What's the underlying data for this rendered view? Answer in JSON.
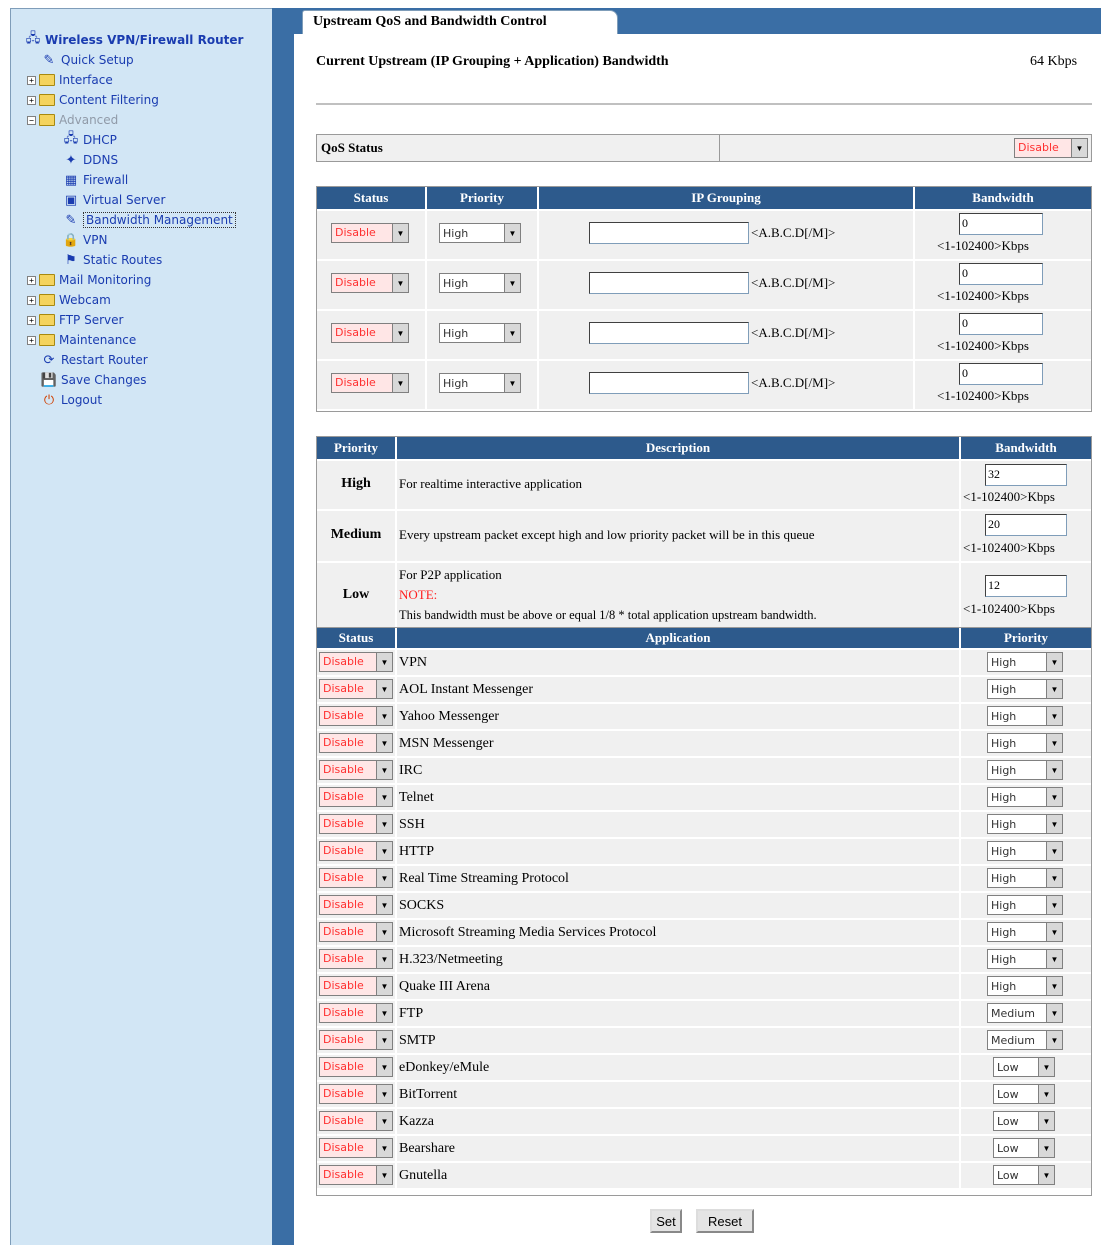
{
  "sidebar": {
    "root": "Wireless VPN/Firewall Router",
    "items": [
      {
        "label": "Quick Setup"
      },
      {
        "label": "Interface"
      },
      {
        "label": "Content Filtering"
      },
      {
        "label": "Advanced"
      },
      {
        "label": "DHCP"
      },
      {
        "label": "DDNS"
      },
      {
        "label": "Firewall"
      },
      {
        "label": "Virtual Server"
      },
      {
        "label": "Bandwidth Management"
      },
      {
        "label": "VPN"
      },
      {
        "label": "Static Routes"
      },
      {
        "label": "Mail Monitoring"
      },
      {
        "label": "Webcam"
      },
      {
        "label": "FTP Server"
      },
      {
        "label": "Maintenance"
      },
      {
        "label": "Restart Router"
      },
      {
        "label": "Save Changes"
      },
      {
        "label": "Logout"
      }
    ]
  },
  "tab": {
    "title": "Upstream QoS and Bandwidth Control"
  },
  "current": {
    "label": "Current Upstream (IP Grouping + Application) Bandwidth",
    "value": "64 Kbps"
  },
  "qos": {
    "label": "QoS Status",
    "value": "Disable"
  },
  "ip_table": {
    "headers": [
      "Status",
      "Priority",
      "IP Grouping",
      "Bandwidth"
    ],
    "rows": [
      {
        "status": "Disable",
        "priority": "High",
        "ip": "",
        "ip_hint": "<A.B.C.D[/M]>",
        "bw": "0",
        "bw_hint": "<1-102400>Kbps"
      },
      {
        "status": "Disable",
        "priority": "High",
        "ip": "",
        "ip_hint": "<A.B.C.D[/M]>",
        "bw": "0",
        "bw_hint": "<1-102400>Kbps"
      },
      {
        "status": "Disable",
        "priority": "High",
        "ip": "",
        "ip_hint": "<A.B.C.D[/M]>",
        "bw": "0",
        "bw_hint": "<1-102400>Kbps"
      },
      {
        "status": "Disable",
        "priority": "High",
        "ip": "",
        "ip_hint": "<A.B.C.D[/M]>",
        "bw": "0",
        "bw_hint": "<1-102400>Kbps"
      }
    ]
  },
  "prio_table": {
    "headers": [
      "Priority",
      "Description",
      "Bandwidth"
    ],
    "rows": [
      {
        "priority": "High",
        "desc": "For realtime interactive application",
        "bw": "32",
        "bw_hint": "<1-102400>Kbps"
      },
      {
        "priority": "Medium",
        "desc": "Every upstream packet except high and low priority packet will be in this queue",
        "bw": "20",
        "bw_hint": "<1-102400>Kbps"
      },
      {
        "priority": "Low",
        "desc": "For P2P application",
        "note_label": "NOTE:",
        "note": "This bandwidth must be above or equal 1/8 * total application upstream bandwidth.",
        "bw": "12",
        "bw_hint": "<1-102400>Kbps"
      }
    ]
  },
  "app_table": {
    "headers": [
      "Status",
      "Application",
      "Priority"
    ],
    "rows": [
      {
        "status": "Disable",
        "app": "VPN",
        "priority": "High"
      },
      {
        "status": "Disable",
        "app": "AOL Instant Messenger",
        "priority": "High"
      },
      {
        "status": "Disable",
        "app": "Yahoo Messenger",
        "priority": "High"
      },
      {
        "status": "Disable",
        "app": "MSN Messenger",
        "priority": "High"
      },
      {
        "status": "Disable",
        "app": "IRC",
        "priority": "High"
      },
      {
        "status": "Disable",
        "app": "Telnet",
        "priority": "High"
      },
      {
        "status": "Disable",
        "app": "SSH",
        "priority": "High"
      },
      {
        "status": "Disable",
        "app": "HTTP",
        "priority": "High"
      },
      {
        "status": "Disable",
        "app": "Real Time Streaming Protocol",
        "priority": "High"
      },
      {
        "status": "Disable",
        "app": "SOCKS",
        "priority": "High"
      },
      {
        "status": "Disable",
        "app": "Microsoft Streaming Media Services Protocol",
        "priority": "High"
      },
      {
        "status": "Disable",
        "app": "H.323/Netmeeting",
        "priority": "High"
      },
      {
        "status": "Disable",
        "app": "Quake III Arena",
        "priority": "High"
      },
      {
        "status": "Disable",
        "app": "FTP",
        "priority": "Medium"
      },
      {
        "status": "Disable",
        "app": "SMTP",
        "priority": "Medium"
      },
      {
        "status": "Disable",
        "app": "eDonkey/eMule",
        "priority": "Low"
      },
      {
        "status": "Disable",
        "app": "BitTorrent",
        "priority": "Low"
      },
      {
        "status": "Disable",
        "app": "Kazza",
        "priority": "Low"
      },
      {
        "status": "Disable",
        "app": "Bearshare",
        "priority": "Low"
      },
      {
        "status": "Disable",
        "app": "Gnutella",
        "priority": "Low"
      }
    ]
  },
  "buttons": {
    "set": "Set",
    "reset": "Reset"
  }
}
